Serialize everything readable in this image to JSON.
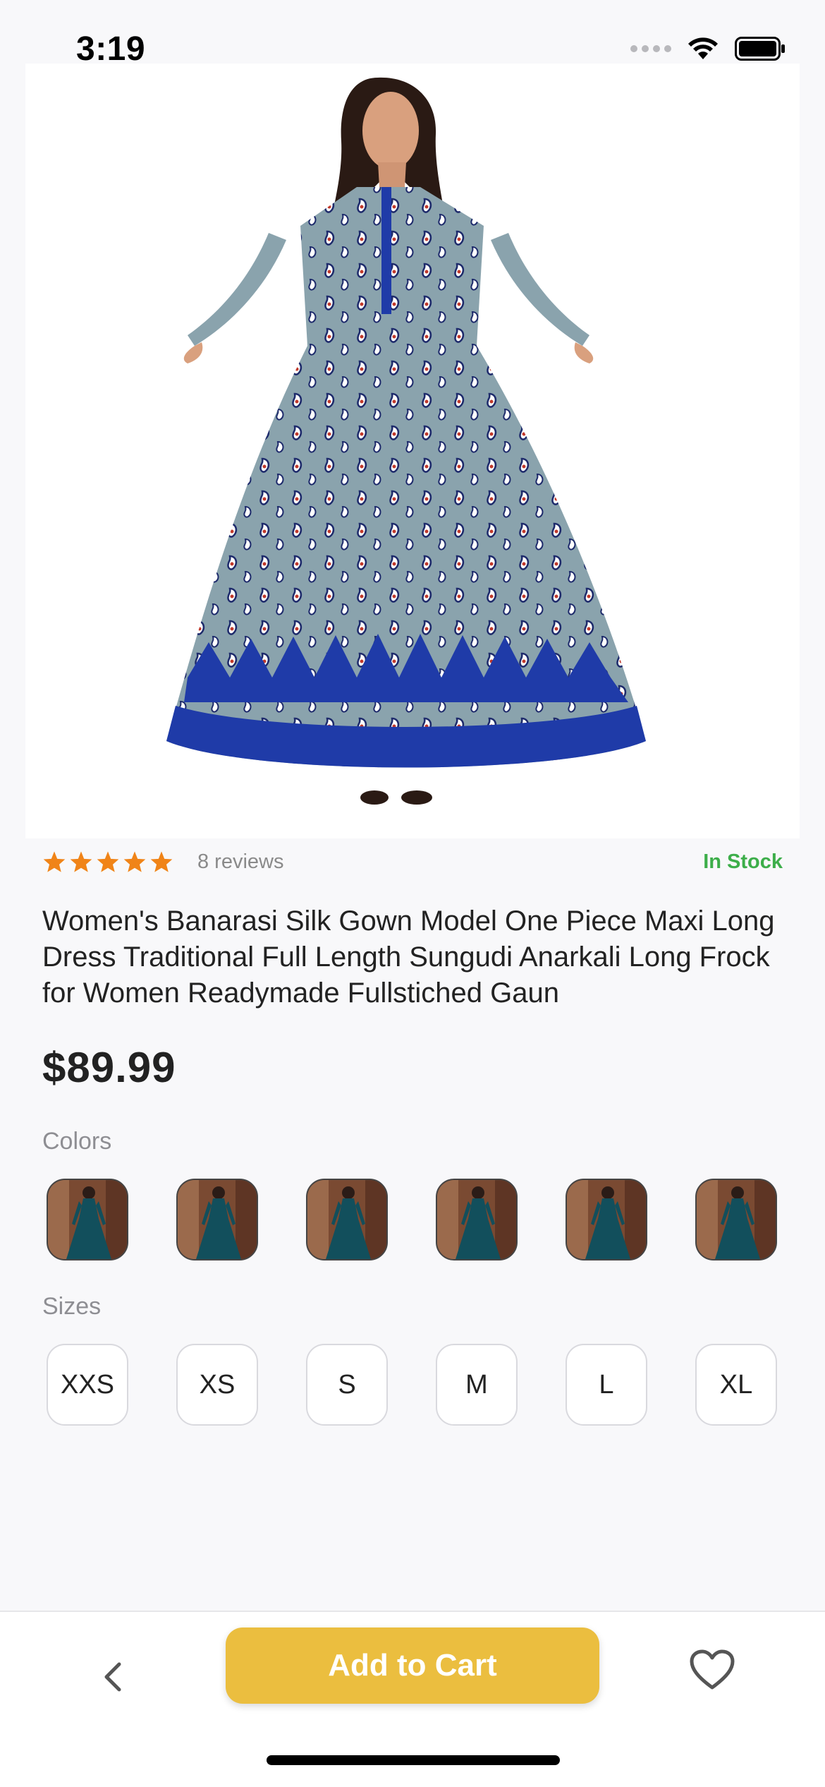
{
  "status_bar": {
    "time": "3:19"
  },
  "product": {
    "rating_stars": 5,
    "reviews": "8 reviews",
    "stock": "In Stock",
    "title": "Women's Banarasi Silk Gown Model One Piece Maxi Long Dress Traditional Full Length Sungudi Anarkali Long Frock for Women Readymade Fullstiched Gaun",
    "price": "$89.99"
  },
  "colors": {
    "label": "Colors",
    "count": 6
  },
  "sizes": {
    "label": "Sizes",
    "options": [
      "XXS",
      "XS",
      "S",
      "M",
      "L",
      "XL"
    ]
  },
  "actions": {
    "add_to_cart": "Add to Cart"
  },
  "theme": {
    "accent": "#ebbe3f",
    "star": "#f08418",
    "stock": "#3dae4a"
  }
}
